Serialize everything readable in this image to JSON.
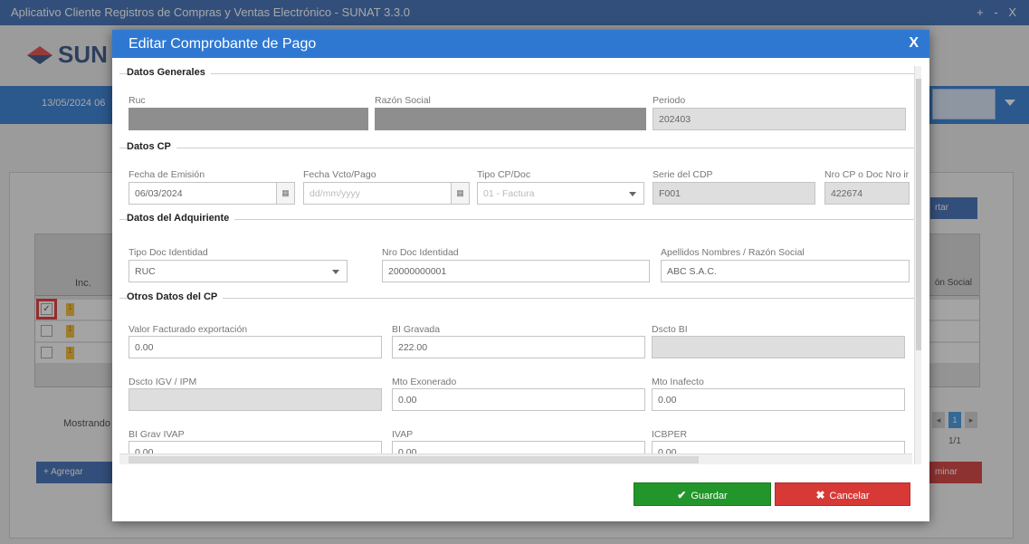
{
  "app": {
    "title": "Aplicativo Cliente Registros de Compras y Ventas Electrónico - SUNAT 3.3.0",
    "window_controls": "+ - X",
    "logo_text": "SUN",
    "date": "13/05/2024 06",
    "table_header_inc": "Inc.",
    "table_header_razon": "ón Social",
    "rows": [
      {
        "checked": "✓",
        "flag": "1"
      },
      {
        "checked": "",
        "flag": "1"
      },
      {
        "checked": "",
        "flag": "1"
      }
    ],
    "showing": "Mostrando d",
    "add_label": "Agregar",
    "delete_label": "minar",
    "export_label": "rtar",
    "page_prev": "◂",
    "page_current": "1",
    "page_next": "▸",
    "page_info": "1/1"
  },
  "modal": {
    "title": "Editar Comprobante de Pago",
    "close": "X",
    "datos_generales": {
      "title": "Datos Generales",
      "ruc_label": "Ruc",
      "ruc_value": "",
      "razon_label": "Razón Social",
      "razon_value": "",
      "periodo_label": "Periodo",
      "periodo_value": "202403"
    },
    "datos_cp": {
      "title": "Datos CP",
      "fecha_emision_label": "Fecha de Emisión",
      "fecha_emision_value": "06/03/2024",
      "fecha_vcto_label": "Fecha Vcto/Pago",
      "fecha_vcto_placeholder": "dd/mm/yyyy",
      "tipo_cp_label": "Tipo CP/Doc",
      "tipo_cp_value": "01 - Factura",
      "serie_label": "Serie del CDP",
      "serie_value": "F001",
      "nro_label": "Nro CP o Doc Nro ir",
      "nro_value": "422674",
      "calendar_glyph": "▦"
    },
    "adquiriente": {
      "title": "Datos del Adquiriente",
      "tipo_doc_label": "Tipo Doc Identidad",
      "tipo_doc_value": "RUC",
      "nro_doc_label": "Nro Doc Identidad",
      "nro_doc_value": "20000000001",
      "nombres_label": "Apellidos Nombres / Razón Social",
      "nombres_value": "ABC S.A.C."
    },
    "otros": {
      "title": "Otros Datos del CP",
      "valor_exp_label": "Valor Facturado exportación",
      "valor_exp_value": "0.00",
      "bi_gravada_label": "BI Gravada",
      "bi_gravada_value": "222.00",
      "dscto_bi_label": "Dscto BI",
      "dscto_bi_value": "",
      "dscto_igv_label": "Dscto IGV / IPM",
      "dscto_igv_value": "",
      "mto_exonerado_label": "Mto Exonerado",
      "mto_exonerado_value": "0.00",
      "mto_inafecto_label": "Mto Inafecto",
      "mto_inafecto_value": "0.00",
      "bi_grav_ivap_label": "BI Grav IVAP",
      "bi_grav_ivap_value": "0.00",
      "ivap_label": "IVAP",
      "ivap_value": "0.00",
      "icbper_label": "ICBPER",
      "icbper_value": "0.00"
    },
    "save_label": "Guardar",
    "save_icon": "✔",
    "cancel_label": "Cancelar",
    "cancel_icon": "✖"
  }
}
